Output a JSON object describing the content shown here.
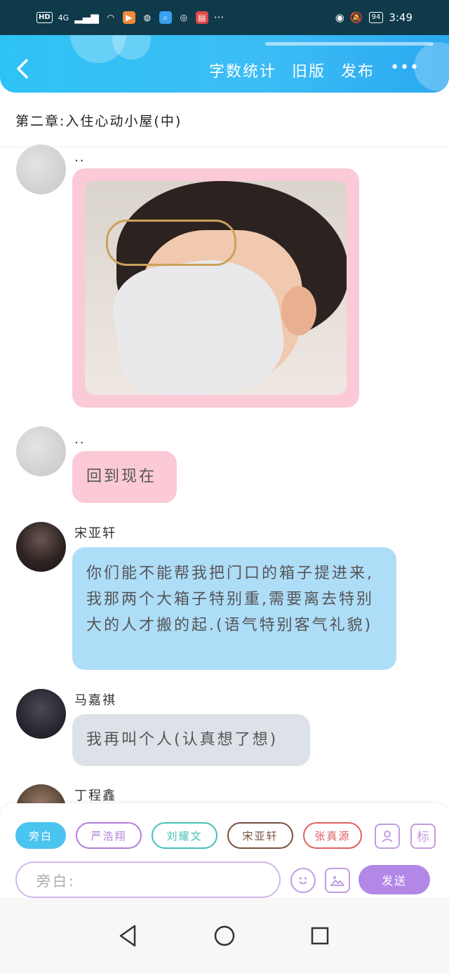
{
  "status_bar": {
    "network": "HD",
    "signal": "4G",
    "time": "3:49",
    "battery": "94"
  },
  "header": {
    "back_icon": "chevron-left-icon",
    "word_count": "字数统计",
    "old_version": "旧版",
    "publish": "发布",
    "more_icon": "more-dots-icon"
  },
  "chapter_title": "第二章:入住心动小屋(中)",
  "messages": [
    {
      "name": "..",
      "type": "image",
      "bubble_color": "#fbcad6"
    },
    {
      "name": "..",
      "text": "回到现在",
      "bubble_color": "#fbcad6"
    },
    {
      "name": "宋亚轩",
      "text": "你们能不能帮我把门口的箱子提进来,我那两个大箱子特别重,需要离去特别大的人才搬的起.(语气特别客气礼貌)",
      "bubble_color": "#aeddf8"
    },
    {
      "name": "马嘉祺",
      "text": "我再叫个人(认真想了想)",
      "bubble_color": "#dde1e8"
    },
    {
      "name": "丁程鑫"
    }
  ],
  "composer": {
    "chips": [
      "旁白",
      "严浩翔",
      "刘耀文",
      "宋亚轩",
      "张真源"
    ],
    "input_placeholder": "旁白:",
    "send_label": "发送",
    "tag_label": "标"
  },
  "nav": [
    "back-triangle-icon",
    "home-circle-icon",
    "recents-square-icon"
  ]
}
